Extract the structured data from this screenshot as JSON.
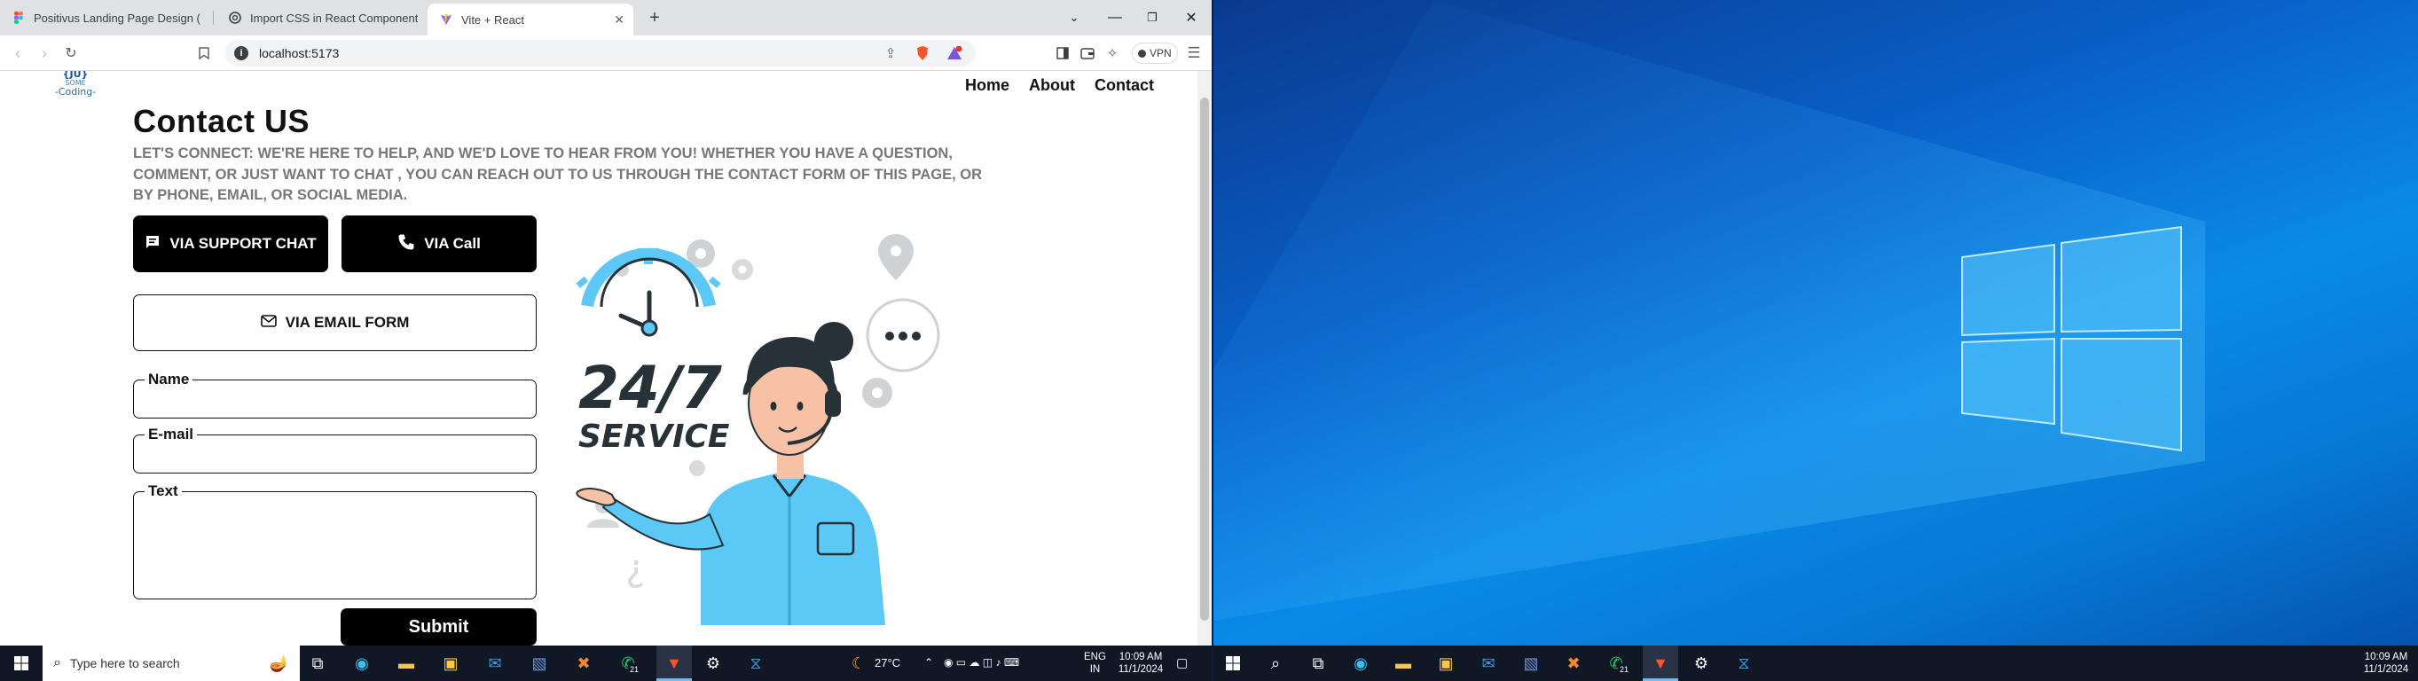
{
  "browser": {
    "tabs": [
      {
        "title": "Positivus Landing Page Design (Con",
        "icon": "figma-icon"
      },
      {
        "title": "Import CSS in React Component",
        "icon": "openai-icon"
      },
      {
        "title": "Vite + React",
        "icon": "vite-icon",
        "active": true
      }
    ],
    "url": "localhost:5173",
    "vpn_label": "VPN",
    "notification_count": "1"
  },
  "site": {
    "logo": {
      "line1": "{JU}",
      "line2": "SOME",
      "line3": "-Coding-"
    },
    "nav": [
      "Home",
      "About",
      "Contact"
    ],
    "heading": "Contact US",
    "intro": "LET'S CONNECT: WE'RE HERE TO HELP, AND WE'D LOVE TO HEAR FROM YOU! WHETHER YOU HAVE A QUESTION, COMMENT, OR JUST WANT TO CHAT , YOU CAN REACH OUT TO US THROUGH THE CONTACT FORM OF THIS PAGE, OR BY PHONE, EMAIL, OR SOCIAL MEDIA.",
    "buttons": {
      "support_chat": "VIA SUPPORT CHAT",
      "call": "VIA Call",
      "email_form": "VIA EMAIL FORM",
      "submit": "Submit"
    },
    "form": {
      "name_label": "Name",
      "email_label": "E-mail",
      "text_label": "Text"
    },
    "illustration": {
      "line1": "24/7",
      "line2": "SERVICE"
    }
  },
  "taskbar_left": {
    "search_placeholder": "Type here to search",
    "weather": "27°C",
    "lang1": "ENG",
    "lang2": "IN",
    "time": "10:09 AM",
    "date": "11/1/2024",
    "whatsapp_badge": "21"
  },
  "taskbar_right": {
    "time": "10:09 AM",
    "date": "11/1/2024",
    "whatsapp_badge": "21"
  },
  "colors": {
    "accent_blue": "#5bc8f5",
    "dark": "#263238",
    "desktop_blue": "#0a8ae8"
  }
}
